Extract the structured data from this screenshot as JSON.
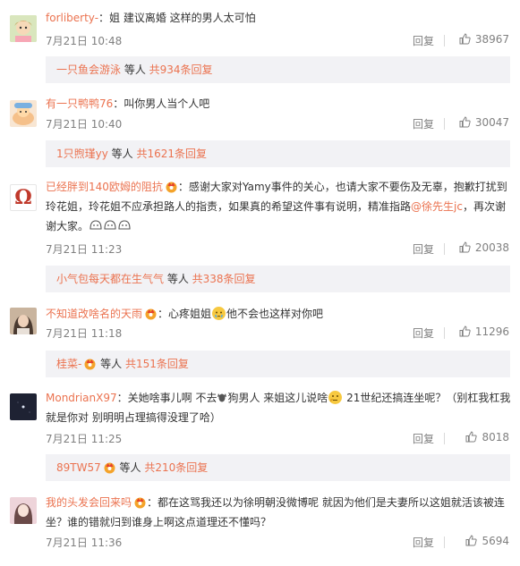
{
  "comments": [
    {
      "user": "forliberty-",
      "sep": "：",
      "text": "姐 建议离婚 这样的男人太可怕",
      "time": "7月21日 10:48",
      "reply": "回复",
      "likes": "38967",
      "sub": {
        "user": "一只鱼会游泳",
        "mid": " 等人 ",
        "count": "共934条回复"
      },
      "avatar_color": "#c8d9a8"
    },
    {
      "user": "有一只鸭鸭76",
      "sep": "：",
      "text": "叫你男人当个人吧",
      "time": "7月21日 10:40",
      "reply": "回复",
      "likes": "30047",
      "sub": {
        "user": "1只煦瑾yy",
        "mid": " 等人 ",
        "count": "共1621条回复"
      },
      "avatar_color": "#f3c9a0"
    },
    {
      "user": "已经胖到140欧姆的阻抗",
      "sep": "：",
      "text1": "感谢大家对Yamy事件的关心，也请大家不要伤及无辜，抱歉打扰到",
      "text2": "玲花姐，玲花姐不应承担路人的指责，如果真的希望这件事有说明，精准指路",
      "mention": "@徐先生jc",
      "text3": "，再次谢",
      "text4": "谢大家。",
      "time": "7月21日 11:23",
      "reply": "回复",
      "likes": "20038",
      "sub": {
        "user": "小气包每天都在生气气",
        "mid": " 等人 ",
        "count": "共338条回复"
      },
      "avatar_glyph": "Ω"
    },
    {
      "user": "不知道改啥名的天雨",
      "sep": "：",
      "text_a": "心疼姐姐",
      "text_b": "他不会也这样对你吧",
      "time": "7月21日 11:18",
      "reply": "回复",
      "likes": "11296",
      "sub": {
        "user": "桂菜-",
        "mid": " 等人 ",
        "count": "共151条回复"
      },
      "avatar_color": "#b8a08a"
    },
    {
      "user": "MondrianX97",
      "sep": "：",
      "text1a": "关她啥事儿啊 不去",
      "text1b": "狗男人 来姐这儿说啥",
      "text1c": " 21世纪还搞连坐呢？（别杠我杠我",
      "text2": "就是你对 别明明占理搞得没理了哈）",
      "time": "7月21日 11:25",
      "reply": "回复",
      "likes": "8018",
      "sub": {
        "user": "89TW57",
        "mid": " 等人 ",
        "count": "共210条回复"
      },
      "avatar_color": "#1e2233"
    },
    {
      "user": "我的头发会回来吗",
      "sep": "：",
      "text1": "都在这骂我还以为徐明朝没微博呢 就因为他们是夫妻所以这姐就活该被连",
      "text2": "坐？谁的错就归到谁身上啊这点道理还不懂吗？",
      "time": "7月21日 11:36",
      "reply": "回复",
      "likes": "5694",
      "avatar_color": "#e8c8d0"
    }
  ],
  "colors": {
    "username": "#eb7350",
    "meta": "#808080",
    "sub_bg": "#f2f2f5"
  },
  "icons": {
    "like": "thumbs-up-icon",
    "badge": "crown-badge-icon",
    "emoji": "smiley-emoji-icon"
  }
}
